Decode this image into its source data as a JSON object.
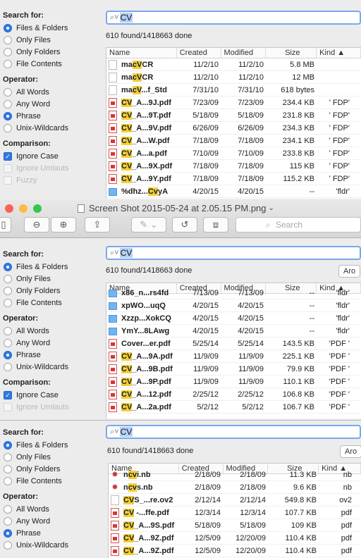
{
  "labels": {
    "search_for": "Search for:",
    "operator": "Operator:",
    "comparison": "Comparison:",
    "query": "CV",
    "status": "610 found/1418663 done",
    "around_btn": "Aro"
  },
  "options": {
    "files_folders": "Files & Folders",
    "only_files": "Only Files",
    "only_folders": "Only Folders",
    "file_contents": "File Contents",
    "all_words": "All Words",
    "any_word": "Any Word",
    "phrase": "Phrase",
    "unix_wildcards": "Unix-Wildcards",
    "ignore_case": "Ignore Case",
    "ignore_umlauts": "Ignore Umlauts",
    "fuzzy": "Fuzzy"
  },
  "columns": {
    "name": "Name",
    "created": "Created",
    "modified": "Modified",
    "size": "Size",
    "kind": "Kind ▲"
  },
  "window": {
    "title": "Screen Shot 2015-05-24 at 2.05.15 PM.png",
    "search_placeholder": "Search"
  },
  "colors": {
    "accent": "#2f7ae5",
    "highlight": "#f1cf3a",
    "close": "#fc605b",
    "minimize": "#fdbc40",
    "zoom": "#34c84a"
  },
  "table1": [
    {
      "icon": "doc",
      "pre": "ma",
      "hl": "cV",
      "post": "CR",
      "created": "11/2/10",
      "modified": "11/2/10",
      "size": "5.8 MB",
      "kind": ""
    },
    {
      "icon": "doc",
      "pre": "ma",
      "hl": "cV",
      "post": "CR",
      "created": "11/2/10",
      "modified": "11/2/10",
      "size": "12 MB",
      "kind": ""
    },
    {
      "icon": "doc",
      "pre": "ma",
      "hl": "cV",
      "post": "...f_Std",
      "created": "7/31/10",
      "modified": "7/31/10",
      "size": "618 bytes",
      "kind": ""
    },
    {
      "icon": "pdf",
      "pre": "",
      "hl": "CV",
      "post": "_A...9J.pdf",
      "created": "7/23/09",
      "modified": "7/23/09",
      "size": "234.4 KB",
      "kind": "' FDP'"
    },
    {
      "icon": "pdf",
      "pre": "",
      "hl": "CV",
      "post": "_A...9T.pdf",
      "created": "5/18/09",
      "modified": "5/18/09",
      "size": "231.8 KB",
      "kind": "' FDP'"
    },
    {
      "icon": "pdf",
      "pre": "",
      "hl": "CV",
      "post": "_A...9V.pdf",
      "created": "6/26/09",
      "modified": "6/26/09",
      "size": "234.3 KB",
      "kind": "' FDP'"
    },
    {
      "icon": "pdf",
      "pre": "",
      "hl": "CV",
      "post": "_A...W.pdf",
      "created": "7/18/09",
      "modified": "7/18/09",
      "size": "234.1 KB",
      "kind": "' FDP'"
    },
    {
      "icon": "pdf",
      "pre": "",
      "hl": "CV",
      "post": "_A...a.pdf",
      "created": "7/10/09",
      "modified": "7/10/09",
      "size": "233.8 KB",
      "kind": "' FDP'"
    },
    {
      "icon": "pdf",
      "pre": "",
      "hl": "CV",
      "post": "_A...9X.pdf",
      "created": "7/18/09",
      "modified": "7/18/09",
      "size": "115 KB",
      "kind": "' FDP'"
    },
    {
      "icon": "pdf",
      "pre": "",
      "hl": "CV",
      "post": "_A...9Y.pdf",
      "created": "7/18/09",
      "modified": "7/18/09",
      "size": "115.2 KB",
      "kind": "' FDP'"
    },
    {
      "icon": "folder",
      "pre": "%dhz...",
      "hl": "Cv",
      "post": "yA",
      "created": "4/20/15",
      "modified": "4/20/15",
      "size": "--",
      "kind": "'fldr'"
    }
  ],
  "table2": [
    {
      "icon": "folder",
      "pre": "x86_n...",
      "hl": "",
      "post": "rs4fd",
      "created": "7/13/09",
      "modified": "7/13/09",
      "size": "--",
      "kind": "'fldr'"
    },
    {
      "icon": "folder",
      "pre": "xpWO...",
      "hl": "",
      "post": "uqQ",
      "created": "4/20/15",
      "modified": "4/20/15",
      "size": "--",
      "kind": "'fldr'"
    },
    {
      "icon": "folder",
      "pre": "Xzzp...",
      "hl": "",
      "post": "XokCQ",
      "created": "4/20/15",
      "modified": "4/20/15",
      "size": "--",
      "kind": "'fldr'"
    },
    {
      "icon": "folder",
      "pre": "YmY...",
      "hl": "",
      "post": "8LAwg",
      "created": "4/20/15",
      "modified": "4/20/15",
      "size": "--",
      "kind": "'fldr'"
    },
    {
      "icon": "pdf",
      "pre": "Cover...",
      "hl": "",
      "post": "er.pdf",
      "created": "5/25/14",
      "modified": "5/25/14",
      "size": "143.5 KB",
      "kind": "'PDF '"
    },
    {
      "icon": "pdf",
      "pre": "",
      "hl": "CV",
      "post": "_A...9A.pdf",
      "created": "11/9/09",
      "modified": "11/9/09",
      "size": "225.1 KB",
      "kind": "'PDF '"
    },
    {
      "icon": "pdf",
      "pre": "",
      "hl": "CV",
      "post": "_A...9B.pdf",
      "created": "11/9/09",
      "modified": "11/9/09",
      "size": "79.9 KB",
      "kind": "'PDF '"
    },
    {
      "icon": "pdf",
      "pre": "",
      "hl": "CV",
      "post": "_A...9P.pdf",
      "created": "11/9/09",
      "modified": "11/9/09",
      "size": "110.1 KB",
      "kind": "'PDF '"
    },
    {
      "icon": "pdf",
      "pre": "",
      "hl": "CV",
      "post": "_A...12.pdf",
      "created": "2/25/12",
      "modified": "2/25/12",
      "size": "106.8 KB",
      "kind": "'PDF '"
    },
    {
      "icon": "pdf",
      "pre": "",
      "hl": "CV",
      "post": "_A...2a.pdf",
      "created": "5/2/12",
      "modified": "5/2/12",
      "size": "106.7 KB",
      "kind": "'PDF '"
    }
  ],
  "table3": [
    {
      "icon": "nb",
      "pre": "n",
      "hl": "cv",
      "post": "i.nb",
      "created": "2/18/09",
      "modified": "2/18/09",
      "size": "11.3 KB",
      "kind": "nb"
    },
    {
      "icon": "nb",
      "pre": "n",
      "hl": "cv",
      "post": "s.nb",
      "created": "2/18/09",
      "modified": "2/18/09",
      "size": "9.6 KB",
      "kind": "nb"
    },
    {
      "icon": "doc",
      "pre": "",
      "hl": "CV",
      "post": "S_...re.ov2",
      "created": "2/12/14",
      "modified": "2/12/14",
      "size": "549.8 KB",
      "kind": "ov2"
    },
    {
      "icon": "pdf",
      "pre": "",
      "hl": "CV",
      "post": " -...ffe.pdf",
      "created": "12/3/14",
      "modified": "12/3/14",
      "size": "107.7 KB",
      "kind": "pdf"
    },
    {
      "icon": "pdf",
      "pre": "",
      "hl": "CV",
      "post": "_A...9S.pdf",
      "created": "5/18/09",
      "modified": "5/18/09",
      "size": "109 KB",
      "kind": "pdf"
    },
    {
      "icon": "pdf",
      "pre": "",
      "hl": "CV",
      "post": "_A...9Z.pdf",
      "created": "12/5/09",
      "modified": "12/20/09",
      "size": "110.4 KB",
      "kind": "pdf"
    },
    {
      "icon": "pdf",
      "pre": "",
      "hl": "CV",
      "post": "_A...9Z.pdf",
      "created": "12/5/09",
      "modified": "12/20/09",
      "size": "110.4 KB",
      "kind": "pdf"
    }
  ]
}
